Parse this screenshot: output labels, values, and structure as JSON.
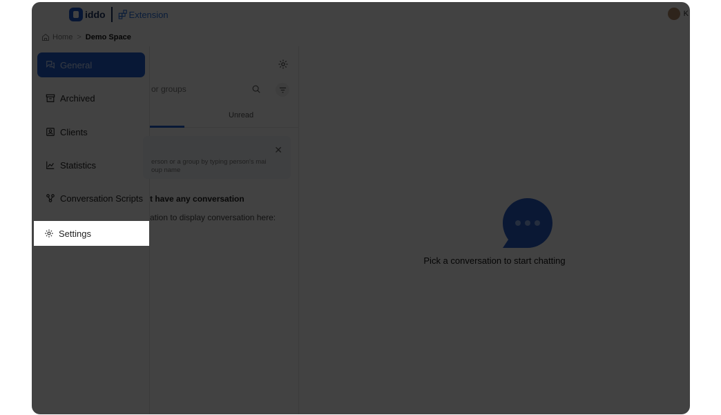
{
  "header": {
    "logo_text": "iddo",
    "extension_label": "Extension",
    "user_initials": "K"
  },
  "breadcrumb": {
    "home": "Home",
    "separator": ">",
    "current": "Demo Space"
  },
  "sidebar": {
    "items": [
      {
        "label": "General",
        "icon": "chat-icon",
        "active": true
      },
      {
        "label": "Archived",
        "icon": "archive-icon"
      },
      {
        "label": "Clients",
        "icon": "contact-card-icon"
      },
      {
        "label": "Statistics",
        "icon": "chart-icon"
      },
      {
        "label": "Conversation Scripts",
        "icon": "flow-icon"
      },
      {
        "label": "Settings",
        "icon": "gear-icon",
        "highlighted": true
      }
    ]
  },
  "list_panel": {
    "search_placeholder": "or groups",
    "tab_unread": "Unread",
    "info_text": "erson or a group by typing person's mai",
    "info_text_2": "oup name",
    "empty_title": "t have any conversation",
    "empty_sub": "ation to display conversation here:"
  },
  "main": {
    "empty_message": "Pick a conversation to start chatting"
  },
  "colors": {
    "primary": "#1f5fcf",
    "overlay": "rgba(0,0,0,0.74)"
  }
}
